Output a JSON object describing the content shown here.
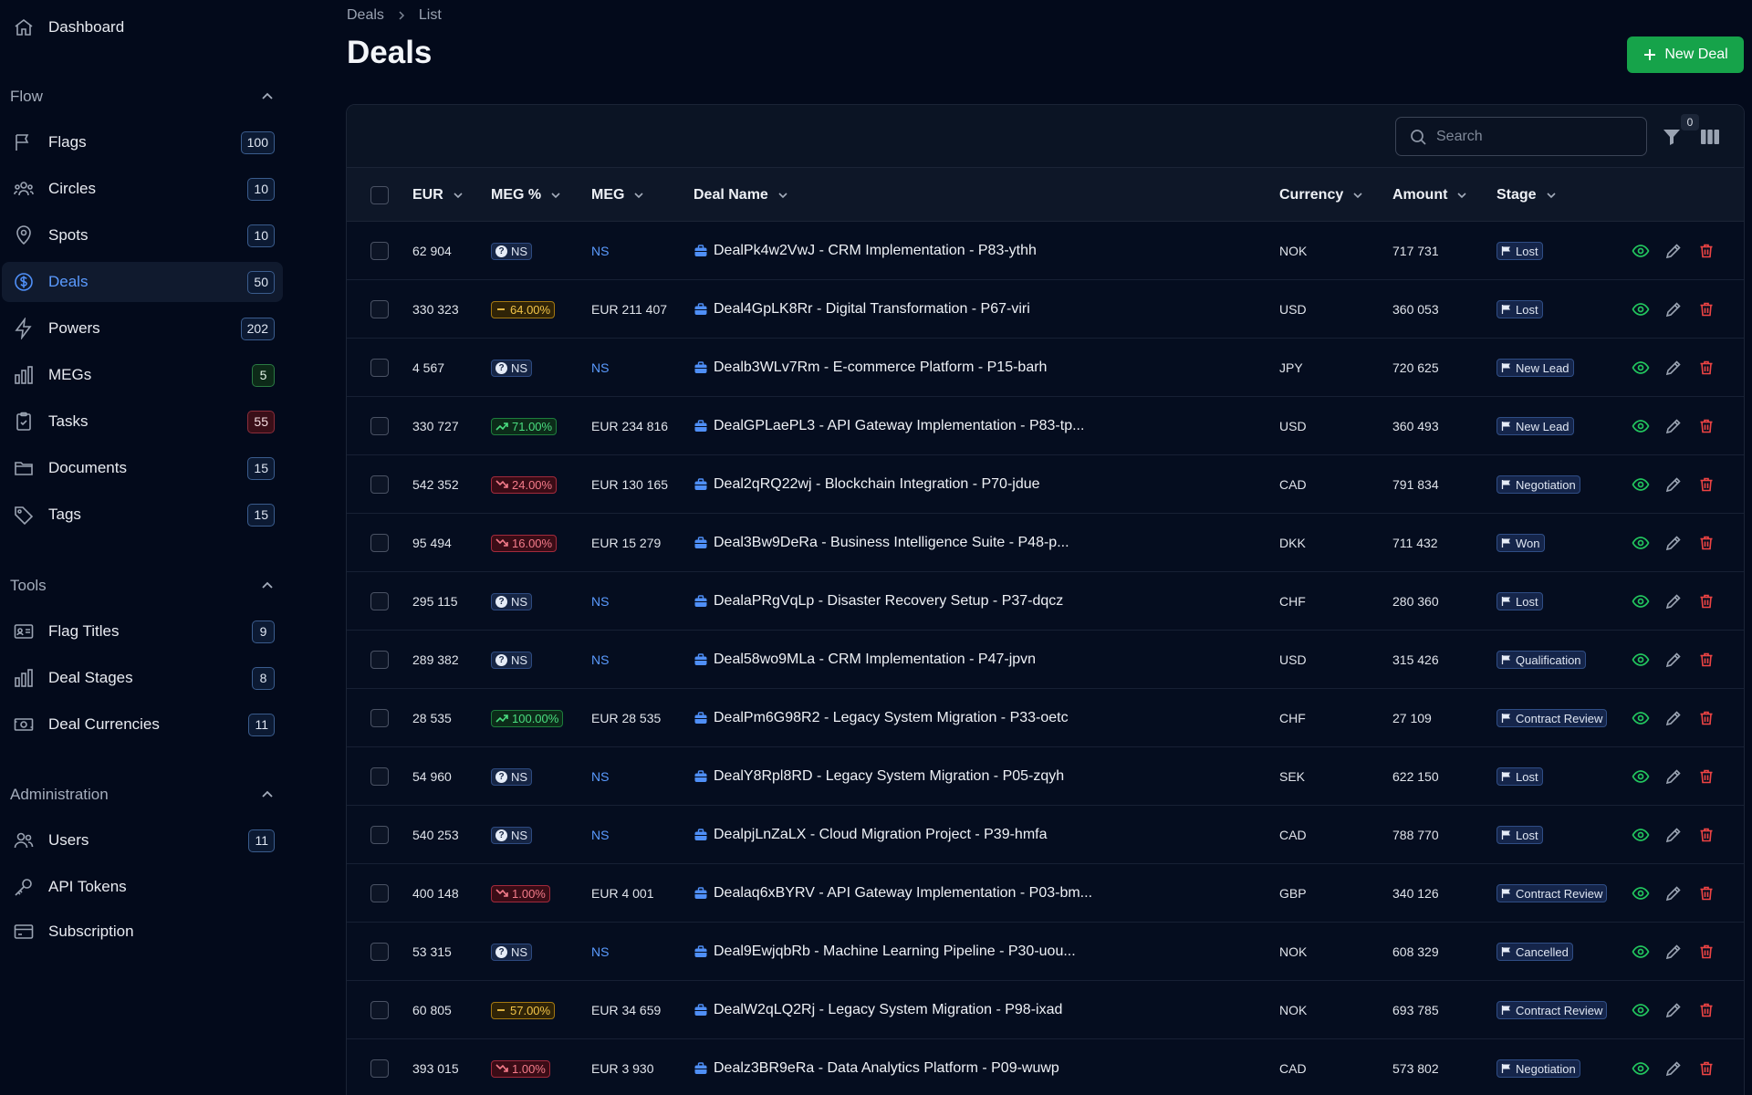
{
  "sidebar": {
    "dashboard": "Dashboard",
    "sections": {
      "flow": "Flow",
      "tools": "Tools",
      "administration": "Administration"
    },
    "flow_items": [
      {
        "label": "Flags",
        "count": "100",
        "tone": "blue"
      },
      {
        "label": "Circles",
        "count": "10",
        "tone": "blue"
      },
      {
        "label": "Spots",
        "count": "10",
        "tone": "blue"
      },
      {
        "label": "Deals",
        "count": "50",
        "tone": "blue",
        "active": true
      },
      {
        "label": "Powers",
        "count": "202",
        "tone": "blue"
      },
      {
        "label": "MEGs",
        "count": "5",
        "tone": "green"
      },
      {
        "label": "Tasks",
        "count": "55",
        "tone": "red"
      },
      {
        "label": "Documents",
        "count": "15",
        "tone": "blue"
      },
      {
        "label": "Tags",
        "count": "15",
        "tone": "blue"
      }
    ],
    "tools_items": [
      {
        "label": "Flag Titles",
        "count": "9"
      },
      {
        "label": "Deal Stages",
        "count": "8"
      },
      {
        "label": "Deal Currencies",
        "count": "11"
      }
    ],
    "admin_items": [
      {
        "label": "Users",
        "count": "11"
      },
      {
        "label": "API Tokens"
      },
      {
        "label": "Subscription"
      }
    ]
  },
  "breadcrumb": [
    "Deals",
    "List"
  ],
  "page_title": "Deals",
  "new_deal_label": "New Deal",
  "search": {
    "placeholder": "Search"
  },
  "filter_count": "0",
  "columns": [
    "EUR",
    "MEG %",
    "MEG",
    "Deal Name",
    "Currency",
    "Amount",
    "Stage"
  ],
  "rows": [
    {
      "eur": "62 904",
      "meg_pct": "NS",
      "pct_type": "ns",
      "meg": "NS",
      "name": "DealPk4w2VwJ - CRM Implementation - P83-ythh",
      "currency": "NOK",
      "amount": "717 731",
      "stage": "Lost"
    },
    {
      "eur": "330 323",
      "meg_pct": "64.00%",
      "pct_type": "flat",
      "meg": "EUR 211 407",
      "name": "Deal4GpLK8Rr - Digital Transformation - P67-viri",
      "currency": "USD",
      "amount": "360 053",
      "stage": "Lost"
    },
    {
      "eur": "4 567",
      "meg_pct": "NS",
      "pct_type": "ns",
      "meg": "NS",
      "name": "Dealb3WLv7Rm - E-commerce Platform - P15-barh",
      "currency": "JPY",
      "amount": "720 625",
      "stage": "New Lead"
    },
    {
      "eur": "330 727",
      "meg_pct": "71.00%",
      "pct_type": "up",
      "meg": "EUR 234 816",
      "name": "DealGPLaePL3 - API Gateway Implementation - P83-tp...",
      "currency": "USD",
      "amount": "360 493",
      "stage": "New Lead"
    },
    {
      "eur": "542 352",
      "meg_pct": "24.00%",
      "pct_type": "down",
      "meg": "EUR 130 165",
      "name": "Deal2qRQ22wj - Blockchain Integration - P70-jdue",
      "currency": "CAD",
      "amount": "791 834",
      "stage": "Negotiation"
    },
    {
      "eur": "95 494",
      "meg_pct": "16.00%",
      "pct_type": "down",
      "meg": "EUR 15 279",
      "name": "Deal3Bw9DeRa - Business Intelligence Suite - P48-p...",
      "currency": "DKK",
      "amount": "711 432",
      "stage": "Won"
    },
    {
      "eur": "295 115",
      "meg_pct": "NS",
      "pct_type": "ns",
      "meg": "NS",
      "name": "DealaPRgVqLp - Disaster Recovery Setup - P37-dqcz",
      "currency": "CHF",
      "amount": "280 360",
      "stage": "Lost"
    },
    {
      "eur": "289 382",
      "meg_pct": "NS",
      "pct_type": "ns",
      "meg": "NS",
      "name": "Deal58wo9MLa - CRM Implementation - P47-jpvn",
      "currency": "USD",
      "amount": "315 426",
      "stage": "Qualification"
    },
    {
      "eur": "28 535",
      "meg_pct": "100.00%",
      "pct_type": "up",
      "meg": "EUR 28 535",
      "name": "DealPm6G98R2 - Legacy System Migration - P33-oetc",
      "currency": "CHF",
      "amount": "27 109",
      "stage": "Contract Review"
    },
    {
      "eur": "54 960",
      "meg_pct": "NS",
      "pct_type": "ns",
      "meg": "NS",
      "name": "DealY8Rpl8RD - Legacy System Migration - P05-zqyh",
      "currency": "SEK",
      "amount": "622 150",
      "stage": "Lost"
    },
    {
      "eur": "540 253",
      "meg_pct": "NS",
      "pct_type": "ns",
      "meg": "NS",
      "name": "DealpjLnZaLX - Cloud Migration Project - P39-hmfa",
      "currency": "CAD",
      "amount": "788 770",
      "stage": "Lost"
    },
    {
      "eur": "400 148",
      "meg_pct": "1.00%",
      "pct_type": "down",
      "meg": "EUR 4 001",
      "name": "Dealaq6xBYRV - API Gateway Implementation - P03-bm...",
      "currency": "GBP",
      "amount": "340 126",
      "stage": "Contract Review"
    },
    {
      "eur": "53 315",
      "meg_pct": "NS",
      "pct_type": "ns",
      "meg": "NS",
      "name": "Deal9EwjqbRb - Machine Learning Pipeline - P30-uou...",
      "currency": "NOK",
      "amount": "608 329",
      "stage": "Cancelled"
    },
    {
      "eur": "60 805",
      "meg_pct": "57.00%",
      "pct_type": "flat",
      "meg": "EUR 34 659",
      "name": "DealW2qLQ2Rj - Legacy System Migration - P98-ixad",
      "currency": "NOK",
      "amount": "693 785",
      "stage": "Contract Review"
    },
    {
      "eur": "393 015",
      "meg_pct": "1.00%",
      "pct_type": "down",
      "meg": "EUR 3 930",
      "name": "Dealz3BR9eRa - Data Analytics Platform - P09-wuwp",
      "currency": "CAD",
      "amount": "573 802",
      "stage": "Negotiation"
    }
  ]
}
